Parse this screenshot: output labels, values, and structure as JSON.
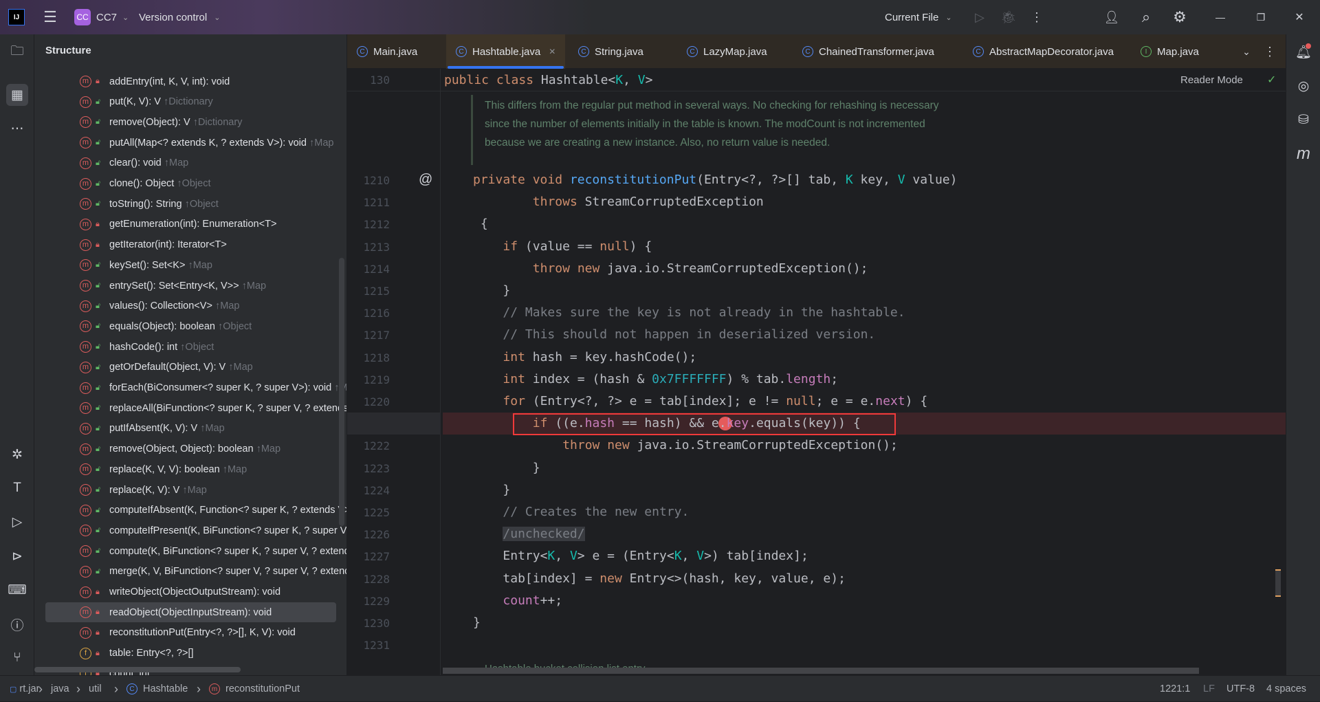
{
  "titlebar": {
    "project_badge": "CC",
    "project_name": "CC7",
    "vcs": "Version control",
    "run_config": "Current File"
  },
  "structure": {
    "title": "Structure",
    "items": [
      {
        "kind": "m",
        "vis": "private",
        "text": "addEntry(int, K, V, int): void",
        "inh": ""
      },
      {
        "kind": "m",
        "vis": "public",
        "text": "put(K, V): V",
        "inh": "↑Dictionary"
      },
      {
        "kind": "m",
        "vis": "public",
        "text": "remove(Object): V",
        "inh": "↑Dictionary"
      },
      {
        "kind": "m",
        "vis": "public",
        "text": "putAll(Map<? extends K, ? extends V>): void",
        "inh": "↑Map"
      },
      {
        "kind": "m",
        "vis": "public",
        "text": "clear(): void",
        "inh": "↑Map"
      },
      {
        "kind": "m",
        "vis": "public",
        "text": "clone(): Object",
        "inh": "↑Object"
      },
      {
        "kind": "m",
        "vis": "public",
        "text": "toString(): String",
        "inh": "↑Object"
      },
      {
        "kind": "m",
        "vis": "private",
        "text": "getEnumeration(int): Enumeration<T>",
        "inh": ""
      },
      {
        "kind": "m",
        "vis": "private",
        "text": "getIterator(int): Iterator<T>",
        "inh": ""
      },
      {
        "kind": "m",
        "vis": "public",
        "text": "keySet(): Set<K>",
        "inh": "↑Map"
      },
      {
        "kind": "m",
        "vis": "public",
        "text": "entrySet(): Set<Entry<K, V>>",
        "inh": "↑Map"
      },
      {
        "kind": "m",
        "vis": "public",
        "text": "values(): Collection<V>",
        "inh": "↑Map"
      },
      {
        "kind": "m",
        "vis": "public",
        "text": "equals(Object): boolean",
        "inh": "↑Object"
      },
      {
        "kind": "m",
        "vis": "public",
        "text": "hashCode(): int",
        "inh": "↑Object"
      },
      {
        "kind": "m",
        "vis": "public",
        "text": "getOrDefault(Object, V): V",
        "inh": "↑Map"
      },
      {
        "kind": "m",
        "vis": "public",
        "text": "forEach(BiConsumer<? super K, ? super V>): void",
        "inh": "↑Map"
      },
      {
        "kind": "m",
        "vis": "public",
        "text": "replaceAll(BiFunction<? super K, ? super V, ? extends V>): void",
        "inh": ""
      },
      {
        "kind": "m",
        "vis": "public",
        "text": "putIfAbsent(K, V): V",
        "inh": "↑Map"
      },
      {
        "kind": "m",
        "vis": "public",
        "text": "remove(Object, Object): boolean",
        "inh": "↑Map"
      },
      {
        "kind": "m",
        "vis": "public",
        "text": "replace(K, V, V): boolean",
        "inh": "↑Map"
      },
      {
        "kind": "m",
        "vis": "public",
        "text": "replace(K, V): V",
        "inh": "↑Map"
      },
      {
        "kind": "m",
        "vis": "public",
        "text": "computeIfAbsent(K, Function<? super K, ? extends V>): V",
        "inh": ""
      },
      {
        "kind": "m",
        "vis": "public",
        "text": "computeIfPresent(K, BiFunction<? super K, ? super V, ? extends V>): V",
        "inh": ""
      },
      {
        "kind": "m",
        "vis": "public",
        "text": "compute(K, BiFunction<? super K, ? super V, ? extends V>): V",
        "inh": ""
      },
      {
        "kind": "m",
        "vis": "public",
        "text": "merge(K, V, BiFunction<? super V, ? super V, ? extends V>): V",
        "inh": ""
      },
      {
        "kind": "m",
        "vis": "private",
        "text": "writeObject(ObjectOutputStream): void",
        "inh": ""
      },
      {
        "kind": "m",
        "vis": "private",
        "text": "readObject(ObjectInputStream): void",
        "inh": "",
        "selected": true
      },
      {
        "kind": "m",
        "vis": "private",
        "text": "reconstitutionPut(Entry<?, ?>[], K, V): void",
        "inh": ""
      },
      {
        "kind": "f",
        "vis": "private",
        "text": "table: Entry<?, ?>[]",
        "inh": ""
      },
      {
        "kind": "f",
        "vis": "private",
        "text": "count: int",
        "inh": ""
      }
    ]
  },
  "tabs": [
    {
      "label": "Main.java",
      "icon": "C"
    },
    {
      "label": "Hashtable.java",
      "icon": "C",
      "active": true
    },
    {
      "label": "String.java",
      "icon": "C"
    },
    {
      "label": "LazyMap.java",
      "icon": "C"
    },
    {
      "label": "ChainedTransformer.java",
      "icon": "C"
    },
    {
      "label": "AbstractMapDecorator.java",
      "icon": "C"
    },
    {
      "label": "Map.java",
      "icon": "I"
    }
  ],
  "editor": {
    "sticky_line": "130",
    "sticky_code": [
      [
        "kw",
        "public class "
      ],
      [
        "",
        "Hashtable<"
      ],
      [
        "tp",
        "K"
      ],
      [
        "",
        ", "
      ],
      [
        "tp",
        "V"
      ],
      [
        "",
        ">"
      ]
    ],
    "reader_mode": "Reader Mode",
    "doc_lines": [
      "This differs from the regular put method in several ways. No checking for rehashing is necessary",
      "since the number of elements initially in the table is known. The modCount is not incremented",
      "because we are creating a new instance. Also, no return value is needed."
    ],
    "bottom_doc": "Hashtable bucket collision list entry",
    "breakpoint_line": "1221",
    "lines": [
      {
        "n": "1210",
        "indent": 0,
        "t": [
          [
            "kw",
            "private void "
          ],
          [
            "fn",
            "reconstitutionPut"
          ],
          [
            "",
            "(Entry<?, ?>[] tab, "
          ],
          [
            "tp",
            "K"
          ],
          [
            "",
            " key, "
          ],
          [
            "tp",
            "V"
          ],
          [
            "",
            " value)"
          ]
        ]
      },
      {
        "n": "1211",
        "indent": 8,
        "t": [
          [
            "kw",
            "throws "
          ],
          [
            "",
            "StreamCorruptedException"
          ]
        ]
      },
      {
        "n": "1212",
        "indent": 1,
        "t": [
          [
            "",
            "{"
          ]
        ]
      },
      {
        "n": "1213",
        "indent": 4,
        "t": [
          [
            "kw",
            "if "
          ],
          [
            "",
            "(value == "
          ],
          [
            "kw",
            "null"
          ],
          [
            "",
            ") {"
          ]
        ]
      },
      {
        "n": "1214",
        "indent": 8,
        "t": [
          [
            "kw",
            "throw new "
          ],
          [
            "",
            "java.io.StreamCorruptedException();"
          ]
        ]
      },
      {
        "n": "1215",
        "indent": 4,
        "t": [
          [
            "",
            "}"
          ]
        ]
      },
      {
        "n": "1216",
        "indent": 4,
        "t": [
          [
            "cm",
            "// Makes sure the key is not already in the hashtable."
          ]
        ]
      },
      {
        "n": "1217",
        "indent": 4,
        "t": [
          [
            "cm",
            "// This should not happen in deserialized version."
          ]
        ]
      },
      {
        "n": "1218",
        "indent": 4,
        "t": [
          [
            "kw",
            "int "
          ],
          [
            "",
            "hash = key.hashCode();"
          ]
        ]
      },
      {
        "n": "1219",
        "indent": 4,
        "t": [
          [
            "kw",
            "int "
          ],
          [
            "",
            "index = (hash & "
          ],
          [
            "nu",
            "0x7FFFFFFF"
          ],
          [
            "",
            ") % tab."
          ],
          [
            "fd",
            "length"
          ],
          [
            "",
            ";"
          ]
        ]
      },
      {
        "n": "1220",
        "indent": 4,
        "t": [
          [
            "kw",
            "for "
          ],
          [
            "",
            "(Entry<?, ?> e = tab[index]; e != "
          ],
          [
            "kw",
            "null"
          ],
          [
            "",
            "; e = e."
          ],
          [
            "fd",
            "next"
          ],
          [
            "",
            ") {"
          ]
        ]
      },
      {
        "n": "",
        "indent": 8,
        "t": [
          [
            "kw",
            "if "
          ],
          [
            "",
            "((e."
          ],
          [
            "fd",
            "hash"
          ],
          [
            "",
            " == hash) && e."
          ],
          [
            "fd",
            "key"
          ],
          [
            "",
            ".equals(key)) {"
          ]
        ]
      },
      {
        "n": "1222",
        "indent": 12,
        "t": [
          [
            "kw",
            "throw new "
          ],
          [
            "",
            "java.io.StreamCorruptedException();"
          ]
        ]
      },
      {
        "n": "1223",
        "indent": 8,
        "t": [
          [
            "",
            "}"
          ]
        ]
      },
      {
        "n": "1224",
        "indent": 4,
        "t": [
          [
            "",
            "}"
          ]
        ]
      },
      {
        "n": "1225",
        "indent": 4,
        "t": [
          [
            "cm",
            "// Creates the new entry."
          ]
        ]
      },
      {
        "n": "1226",
        "indent": 4,
        "t": [
          [
            "an",
            "/unchecked/"
          ]
        ]
      },
      {
        "n": "1227",
        "indent": 4,
        "t": [
          [
            "",
            "Entry<"
          ],
          [
            "tp",
            "K"
          ],
          [
            "",
            ", "
          ],
          [
            "tp",
            "V"
          ],
          [
            "",
            "> e = (Entry<"
          ],
          [
            "tp",
            "K"
          ],
          [
            "",
            ", "
          ],
          [
            "tp",
            "V"
          ],
          [
            "",
            ">) tab[index];"
          ]
        ]
      },
      {
        "n": "1228",
        "indent": 4,
        "t": [
          [
            "",
            "tab[index] = "
          ],
          [
            "kw",
            "new "
          ],
          [
            "",
            "Entry<>(hash, key, value, e);"
          ]
        ]
      },
      {
        "n": "1229",
        "indent": 4,
        "t": [
          [
            "fd",
            "count"
          ],
          [
            "",
            "++;"
          ]
        ]
      },
      {
        "n": "1230",
        "indent": 0,
        "t": [
          [
            "",
            "}"
          ]
        ]
      },
      {
        "n": "1231",
        "indent": 0,
        "t": []
      }
    ]
  },
  "statusbar": {
    "breadcrumbs": [
      "rt.jar",
      "java",
      "util",
      "Hashtable",
      "reconstitutionPut"
    ],
    "position": "1221:1",
    "line_sep": "LF",
    "encoding": "UTF-8",
    "indent": "4 spaces"
  },
  "colors": {
    "accent": "#3574f0",
    "breakpoint": "#e55b5b",
    "highlight_box": "#f03a3a",
    "current_line": "#3d2428"
  }
}
